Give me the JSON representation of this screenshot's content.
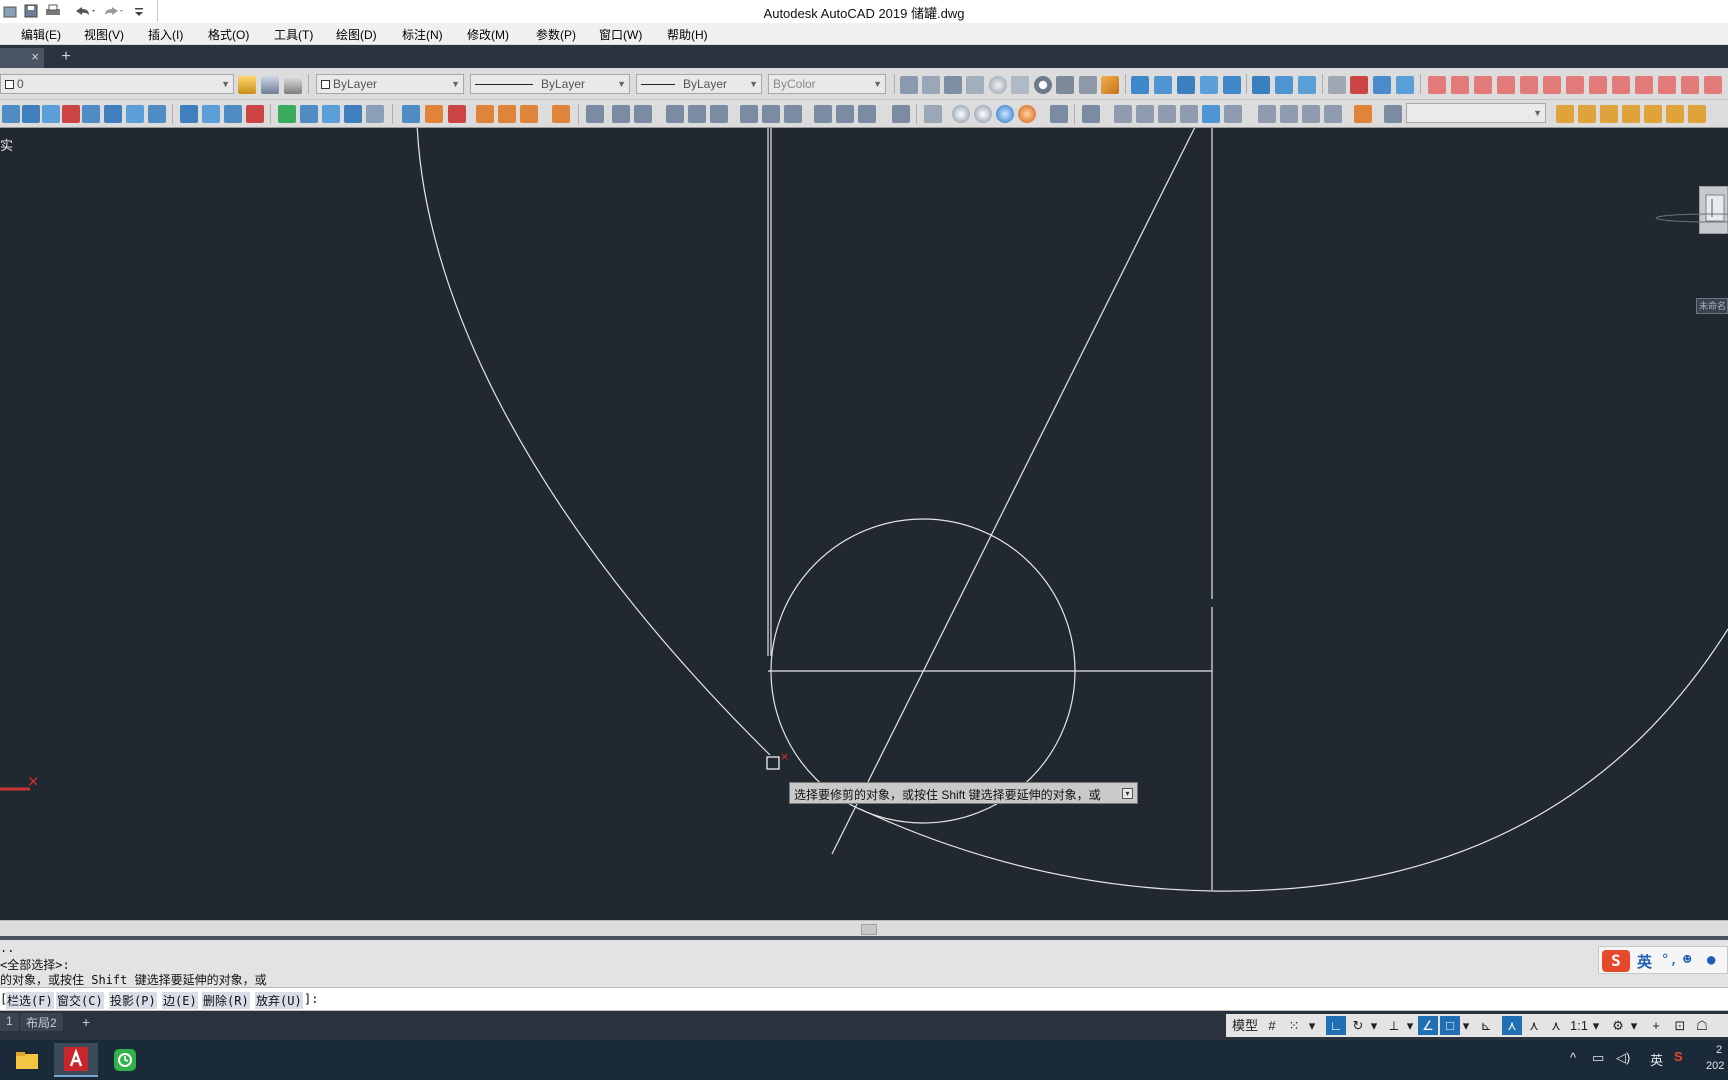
{
  "window": {
    "title": "Autodesk AutoCAD 2019    储罐.dwg"
  },
  "menu": {
    "items": [
      "编辑(E)",
      "视图(V)",
      "插入(I)",
      "格式(O)",
      "工具(T)",
      "绘图(D)",
      "标注(N)",
      "修改(M)",
      "参数(P)",
      "窗口(W)",
      "帮助(H)"
    ]
  },
  "tabs": {
    "new_tab": "+",
    "close": "×"
  },
  "layer_toolbar": {
    "layer_value": "0",
    "color_value": "ByLayer",
    "linetype_value": "ByLayer",
    "lineweight_value": "ByLayer",
    "plotstyle_value": "ByColor"
  },
  "canvas": {
    "view_label": "实",
    "tooltip_text": "选择要修剪的对象，或按住 Shift 键选择要延伸的对象，或",
    "viewcube_label": "未命名"
  },
  "command": {
    "history_line1": "..",
    "history_line2": "<全部选择>:",
    "history_line3": "的对象，或按住 Shift 键选择要延伸的对象，或",
    "prompt_prefix": "[",
    "options": [
      "栏选(F)",
      "窗交(C)",
      "投影(P)",
      "边(E)",
      "删除(R)",
      "放弃(U)"
    ],
    "prompt_suffix": "]:"
  },
  "layout_tabs": [
    "1",
    "布局2"
  ],
  "layout_add": "+",
  "status": {
    "model_label": "模型",
    "scale_label": "1:1"
  },
  "ime": {
    "logo": "S",
    "lang": "英",
    "punct": "°,"
  },
  "tray": {
    "lang": "英",
    "time_partial": "2",
    "date_partial": "202"
  },
  "colors": {
    "canvas_bg": "#212830",
    "drawing_line": "#e6e6e6",
    "status_on": "#1f6fb2",
    "ime_brand": "#e5492c"
  }
}
